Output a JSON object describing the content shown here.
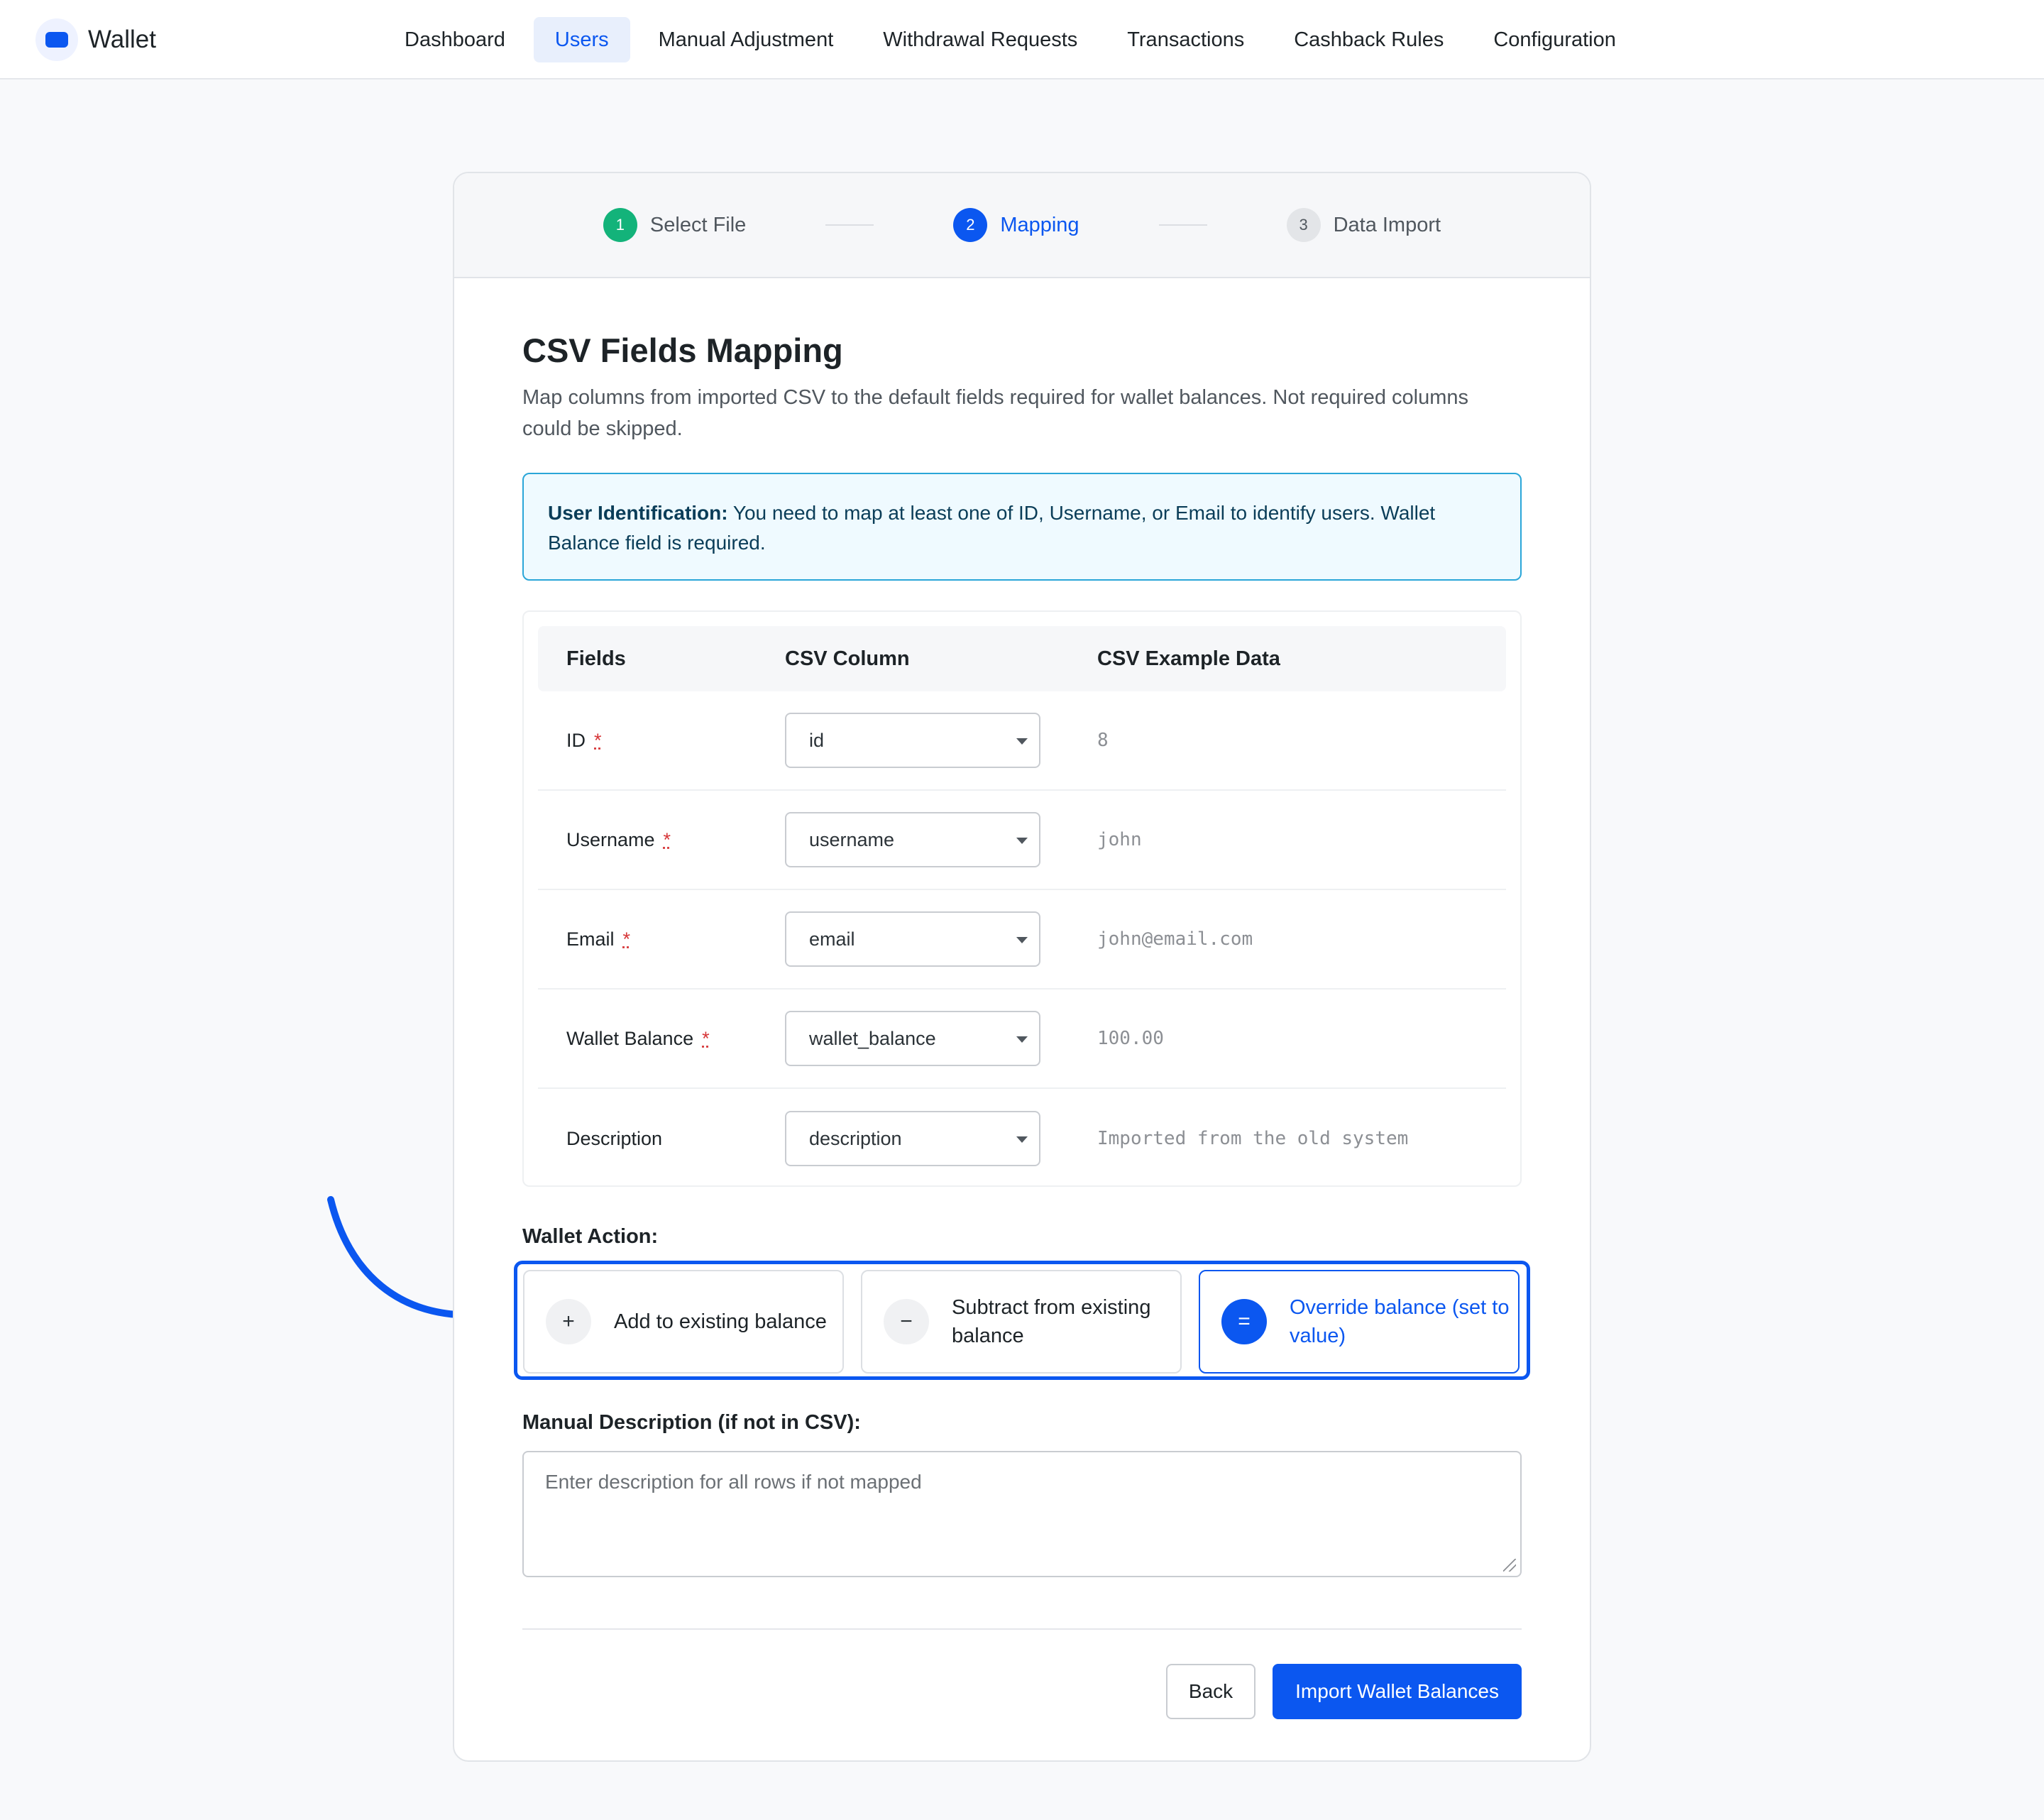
{
  "brand": {
    "name": "Wallet",
    "icon": "wallet-icon",
    "accent": "#0b57f0"
  },
  "nav": {
    "items": [
      "Dashboard",
      "Users",
      "Manual Adjustment",
      "Withdrawal Requests",
      "Transactions",
      "Cashback Rules",
      "Configuration"
    ],
    "active": "Users"
  },
  "steps": [
    {
      "num": "1",
      "label": "Select File",
      "state": "done",
      "color": "#13b37a"
    },
    {
      "num": "2",
      "label": "Mapping",
      "state": "current",
      "color": "#0b57f0"
    },
    {
      "num": "3",
      "label": "Data Import",
      "state": "todo"
    }
  ],
  "page": {
    "title": "CSV Fields Mapping",
    "subtitle": "Map columns from imported CSV to the default fields required for wallet balances. Not required columns could be skipped."
  },
  "notice": {
    "strong": "User Identification:",
    "text": " You need to map at least one of ID, Username, or Email to identify users. Wallet Balance field is required.",
    "border_color": "#2aa6d8"
  },
  "table": {
    "headers": [
      "Fields",
      "CSV Column",
      "CSV Example Data"
    ],
    "required_mark": "*",
    "rows": [
      {
        "field": "ID",
        "required": true,
        "column": "id",
        "example": "8"
      },
      {
        "field": "Username",
        "required": true,
        "column": "username",
        "example": "john"
      },
      {
        "field": "Email",
        "required": true,
        "column": "email",
        "example": "john@email.com"
      },
      {
        "field": "Wallet Balance",
        "required": true,
        "column": "wallet_balance",
        "example": "100.00"
      },
      {
        "field": "Description",
        "required": false,
        "column": "description",
        "example": "Imported from the old system"
      }
    ]
  },
  "wallet_action": {
    "label": "Wallet Action:",
    "options": [
      {
        "symbol": "+",
        "label": "Add to existing balance",
        "icon": "plus-icon"
      },
      {
        "symbol": "−",
        "label": "Subtract from existing balance",
        "icon": "minus-icon"
      },
      {
        "symbol": "=",
        "label": "Override balance (set to value)",
        "icon": "equals-icon"
      }
    ],
    "selected": "Override balance (set to value)"
  },
  "manual_description": {
    "label": "Manual Description (if not in CSV):",
    "placeholder": "Enter description for all rows if not mapped",
    "value": ""
  },
  "buttons": {
    "back": "Back",
    "import": "Import Wallet Balances"
  }
}
